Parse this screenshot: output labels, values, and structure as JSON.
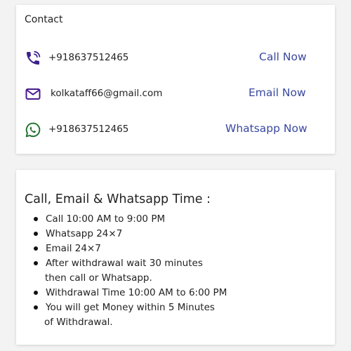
{
  "contact": {
    "title": "Contact",
    "rows": [
      {
        "icon": "phone-ringing-icon",
        "value": "+918637512465",
        "action": "Call Now"
      },
      {
        "icon": "email-icon",
        "value": "kolkataff66@gmail.com",
        "action": "Email Now"
      },
      {
        "icon": "whatsapp-icon",
        "value": "+918637512465",
        "action": "Whatsapp Now"
      }
    ]
  },
  "time": {
    "title": "Call, Email & Whatsapp Time :",
    "items": [
      {
        "text": "Call 10:00 AM to 9:00 PM"
      },
      {
        "text": "Whatsapp  24×7"
      },
      {
        "text": "Email 24×7"
      },
      {
        "text": "After withdrawal wait 30 minutes",
        "continuation": "then call or Whatsapp."
      },
      {
        "text": "Withdrawal Time 10:00 AM to 6:00 PM"
      },
      {
        "text": "You will get Money within 5 Minutes",
        "continuation": "of Withdrawal."
      }
    ]
  },
  "colors": {
    "action_link": "#3a48a0",
    "phone_icon": "#3b1f8a",
    "email_icon": "#4a1a8c",
    "whatsapp_icon": "#1f6e2a",
    "page_background": "#f3f3f3",
    "card_background": "#ffffff"
  }
}
